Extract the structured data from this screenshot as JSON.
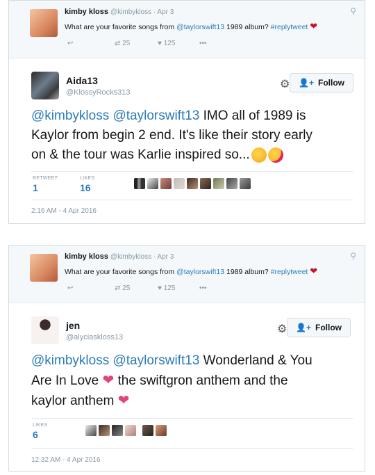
{
  "tweets": [
    {
      "parent": {
        "name": "kimby kloss",
        "meta": "@kimbykloss · Apr 3",
        "text_prefix": "What are your favorite songs from ",
        "mention": "@taylorswift13",
        "text_mid": " 1989 album? ",
        "hashtag": "#replytweet",
        "heart": "❤",
        "retweets": "25",
        "likes": "125",
        "more": "•••"
      },
      "main": {
        "name": "Aida13",
        "handle": "@KlossyRocks313",
        "follow_label": "Follow",
        "mentions": "@kimbykloss @taylorswift13",
        "text_line1": " IMO all of 1989 is",
        "text_line2": "Kaylor from begin 2 end. It's like their story early",
        "text_line3": "on & the tour was Karlie inspired so...",
        "retweets_label": "RETWEET",
        "retweets": "1",
        "likes_label": "LIKES",
        "likes": "16",
        "timestamp": "2:16 AM - 4 Apr 2016"
      }
    },
    {
      "parent": {
        "name": "kimby kloss",
        "meta": "@kimbykloss · Apr 3",
        "text_prefix": "What are your favorite songs from ",
        "mention": "@taylorswift13",
        "text_mid": " 1989 album? ",
        "hashtag": "#replytweet",
        "heart": "❤",
        "retweets": "25",
        "likes": "125",
        "more": "•••"
      },
      "main": {
        "name": "jen",
        "handle": "@alyciaskloss13",
        "follow_label": "Follow",
        "mentions": "@kimbykloss @taylorswift13",
        "text_line1": " Wonderland & You",
        "text_line2": "Are In Love",
        "text_line2b": "the swiftgron anthem and the",
        "text_line3": "kaylor anthem",
        "likes_label": "LIKES",
        "likes": "6",
        "timestamp": "12:32 AM - 4 Apr 2016"
      }
    }
  ],
  "icons": {
    "reply": "↩",
    "retweet": "⇄",
    "like": "♥",
    "gear": "⚙",
    "follow": "➕",
    "location": "⚲"
  },
  "colors": {
    "link": "#2b7bb9",
    "heart": "#c0152d",
    "muted": "#8899a6"
  }
}
